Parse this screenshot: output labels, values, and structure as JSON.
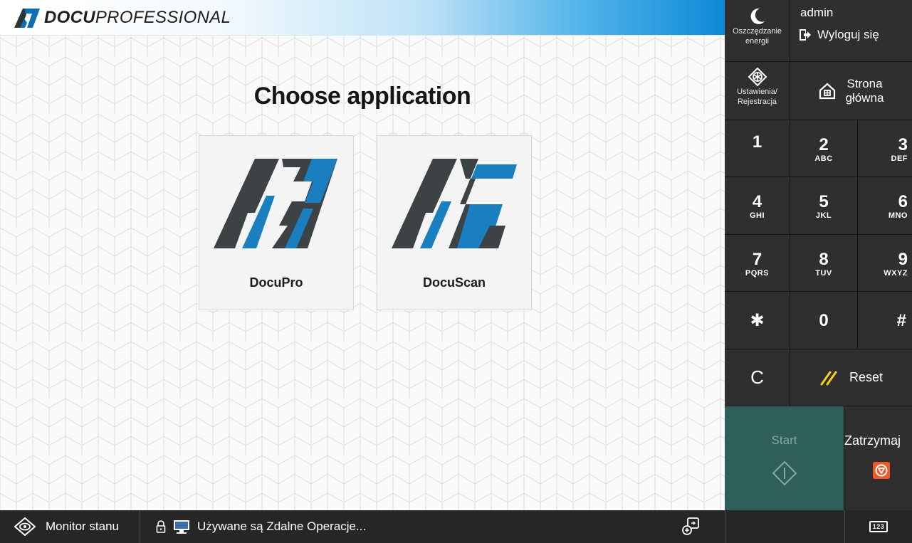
{
  "brand": {
    "bold": "DOCU",
    "light": "PROFESSIONAL"
  },
  "main": {
    "title": "Choose application",
    "apps": [
      {
        "label": "DocuPro"
      },
      {
        "label": "DocuScan"
      }
    ]
  },
  "panel": {
    "energy_label_1": "Oszczędzanie",
    "energy_label_2": "energii",
    "user_name": "admin",
    "logout_label": "Wyloguj się",
    "settings_label_1": "Ustawienia/",
    "settings_label_2": "Rejestracja",
    "home_label_1": "Strona",
    "home_label_2": "główna",
    "keys": [
      {
        "num": "1",
        "sub": ""
      },
      {
        "num": "2",
        "sub": "ABC"
      },
      {
        "num": "3",
        "sub": "DEF"
      },
      {
        "num": "4",
        "sub": "GHI"
      },
      {
        "num": "5",
        "sub": "JKL"
      },
      {
        "num": "6",
        "sub": "MNO"
      },
      {
        "num": "7",
        "sub": "PQRS"
      },
      {
        "num": "8",
        "sub": "TUV"
      },
      {
        "num": "9",
        "sub": "WXYZ"
      },
      {
        "num": "✱",
        "sub": ""
      },
      {
        "num": "0",
        "sub": ""
      },
      {
        "num": "#",
        "sub": ""
      }
    ],
    "clear_label": "C",
    "reset_label": "Reset",
    "start_label": "Start",
    "stop_label": "Zatrzymaj"
  },
  "statusbar": {
    "monitor_label": "Monitor stanu",
    "message": "Używane są Zdalne Operacje...",
    "keypad_label": "123"
  },
  "colors": {
    "brand_blue": "#0c8ad6",
    "logo_gray": "#3d4345",
    "logo_blue": "#1a7fc1",
    "start_green": "#2f5f5a",
    "stop_orange": "#f05a28",
    "reset_yellow": "#f2d31b"
  },
  "icons": {
    "energy": "moon-icon",
    "logout": "logout-icon",
    "settings": "settings-icon",
    "home": "home-icon",
    "reset": "reset-slash-icon",
    "start": "start-diamond-icon",
    "stop": "stop-icon",
    "monitor": "eye-diamond-icon",
    "lock": "lock-icon",
    "remote": "remote-screen-icon",
    "remote_ops": "remote-operation-icon",
    "keypad": "keypad-icon"
  }
}
